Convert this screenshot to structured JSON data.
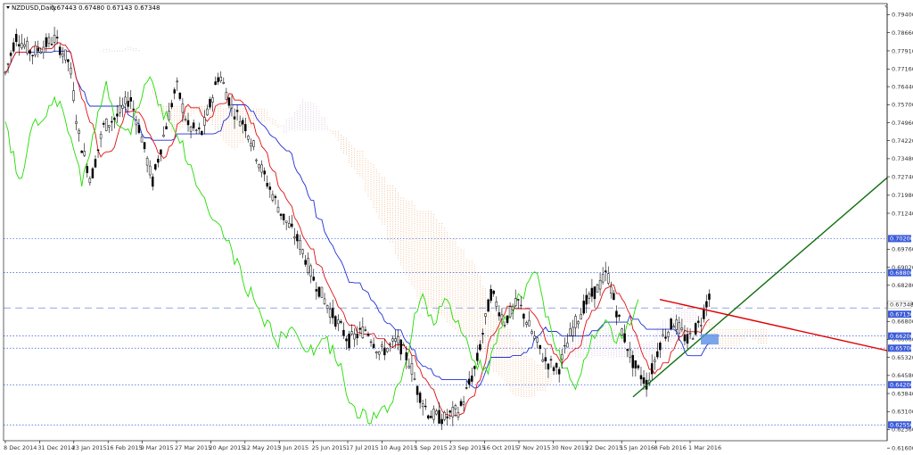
{
  "header": {
    "symbol_label": "NZDUSD,Daily",
    "ohlc": "0.67443 0.67480 0.67143 0.67348"
  },
  "chart_data": {
    "type": "candlestick",
    "title": "NZDUSD,Daily",
    "ylim": [
      0.619,
      0.7985
    ],
    "x_tick_labels": [
      "8 Dec 2014",
      "31 Dec 2014",
      "23 Jan 2015",
      "16 Feb 2015",
      "9 Mar 2015",
      "27 Mar 2015",
      "20 Apr 2015",
      "12 May 2015",
      "3 Jun 2015",
      "25 Jun 2015",
      "17 Jul 2015",
      "10 Aug 2015",
      "1 Sep 2015",
      "23 Sep 2015",
      "16 Oct 2015",
      "7 Nov 2015",
      "30 Nov 2015",
      "22 Dec 2015",
      "15 Jan 2016",
      "8 Feb 2016",
      "1 Mar 2016"
    ],
    "y_tick_labels": [
      "0.79400",
      "0.78660",
      "0.77910",
      "0.77160",
      "0.76440",
      "0.75700",
      "0.74960",
      "0.74220",
      "0.73480",
      "0.72740",
      "0.71980",
      "0.71240",
      "0.69760",
      "0.69020",
      "0.68280",
      "0.67540",
      "0.66800",
      "0.66060",
      "0.65320",
      "0.64580",
      "0.63840",
      "0.63100",
      "0.62360",
      "0.61600"
    ],
    "horizontal_levels": [
      {
        "label": "0.70200",
        "value": 0.702,
        "color": "#3b5bd9",
        "style": "dotted"
      },
      {
        "label": "0.68800",
        "value": 0.688,
        "color": "#3b5bd9",
        "style": "dotted"
      },
      {
        "label": "0.66200",
        "value": 0.662,
        "color": "#3b5bd9",
        "style": "dotted"
      },
      {
        "label": "0.65700",
        "value": 0.657,
        "color": "#3b5bd9",
        "style": "dotted"
      },
      {
        "label": "0.64200",
        "value": 0.642,
        "color": "#3b5bd9",
        "style": "dotted"
      },
      {
        "label": "0.62550",
        "value": 0.6255,
        "color": "#3b5bd9",
        "style": "dotted"
      }
    ],
    "current_price": {
      "label": "0.67348",
      "value": 0.67348,
      "color": "#8fa8e0"
    },
    "highlight_price": {
      "label": "0.67130",
      "value": 0.6713
    },
    "colors": {
      "candle": "#000000",
      "tenkan": "#e01010",
      "kijun": "#1f2fd8",
      "chikou": "#22dd00",
      "cloud": "#e89a5a",
      "cloud_alt": "#c8a0c8",
      "trend_up": "#107010",
      "trend_down": "#e00000",
      "level_label_bg": "#3b5bd9",
      "current_label_bg": "#8fa8e0",
      "box": "#5a8ee6"
    },
    "grid": false
  }
}
